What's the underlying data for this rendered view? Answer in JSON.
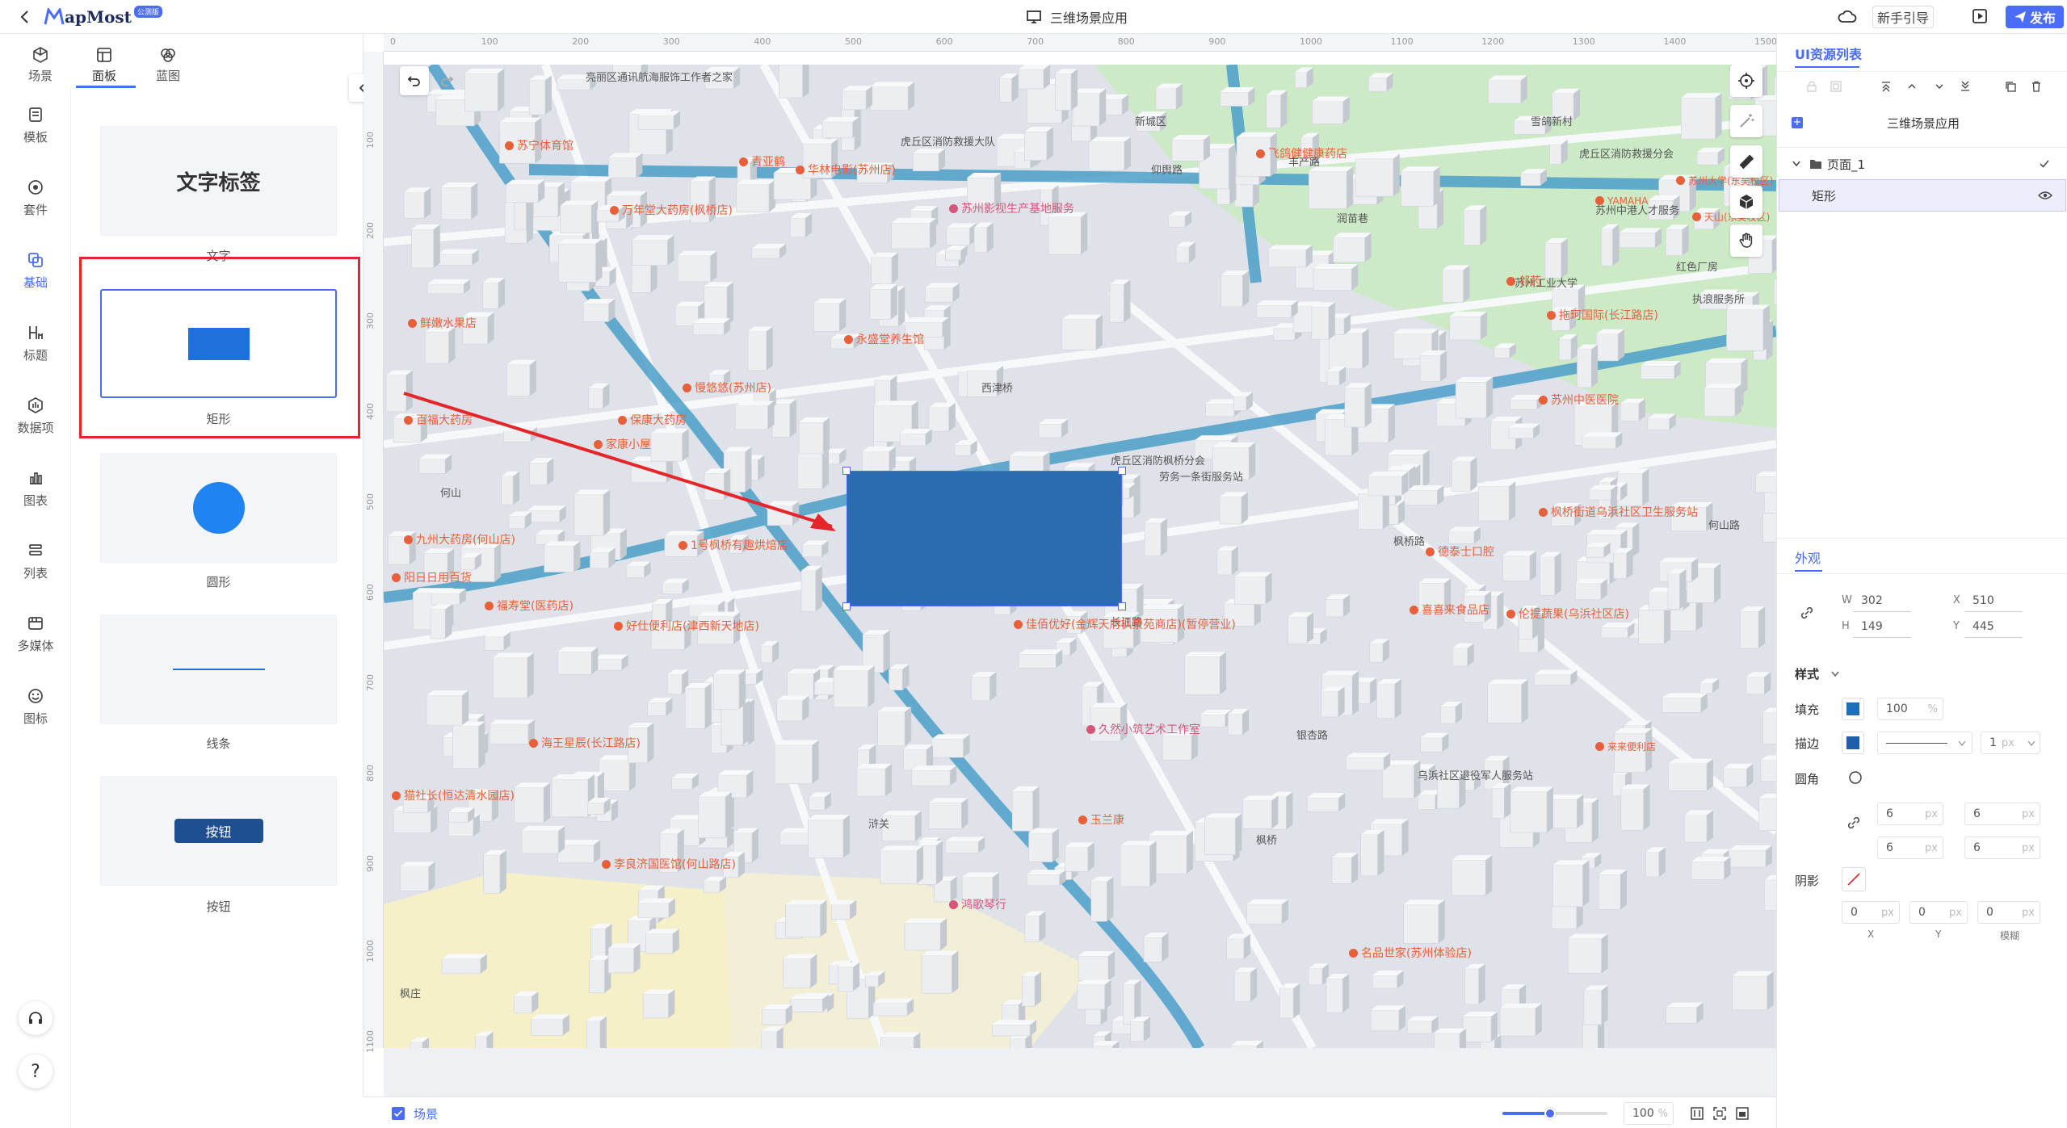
{
  "app": {
    "logo_text": "apMost",
    "logo_badge": "公测版",
    "title": "三维场景应用",
    "guide_label": "新手引导",
    "publish_label": "发布"
  },
  "top_tabs": [
    {
      "label": "场景",
      "icon": "scene-icon"
    },
    {
      "label": "面板",
      "icon": "panel-icon"
    },
    {
      "label": "蓝图",
      "icon": "blueprint-icon"
    }
  ],
  "rail": [
    {
      "label": "模板",
      "icon": "template-icon"
    },
    {
      "label": "套件",
      "icon": "suite-icon"
    },
    {
      "label": "基础",
      "icon": "basic-icon",
      "active": true
    },
    {
      "label": "标题",
      "icon": "heading-icon"
    },
    {
      "label": "数据项",
      "icon": "data-item-icon"
    },
    {
      "label": "图表",
      "icon": "chart-icon"
    },
    {
      "label": "列表",
      "icon": "list-icon"
    },
    {
      "label": "多媒体",
      "icon": "media-icon"
    },
    {
      "label": "图标",
      "icon": "emoji-icon"
    }
  ],
  "components": {
    "text": {
      "preview": "文字标签",
      "label": "文字"
    },
    "rect": {
      "label": "矩形"
    },
    "circle": {
      "label": "圆形"
    },
    "line": {
      "label": "线条"
    },
    "button": {
      "preview": "按钮",
      "label": "按钮"
    }
  },
  "ruler": {
    "top": [
      "0",
      "100",
      "200",
      "300",
      "400",
      "500",
      "600",
      "700",
      "800",
      "900",
      "1000",
      "1100",
      "1200",
      "1300",
      "1400",
      "1500"
    ],
    "left": [
      "100",
      "200",
      "300",
      "400",
      "500",
      "600",
      "700",
      "800",
      "900",
      "1000",
      "1100"
    ]
  },
  "map": {
    "labels": [
      "亮丽区通讯航海服饰工作者之家",
      "虎丘区消防救援大队",
      "新城区",
      "仰舆路",
      "丰产路",
      "润苗巷",
      "雪鸽新村",
      "虎丘区消防救援分会",
      "苏州中港人才服务",
      "红色厂房",
      "枫桥路",
      "西津桥",
      "虎丘区消防枫桥分会",
      "劳务一条街服务站",
      "何山",
      "乌浜社区退役军人服务站",
      "执浪服务所",
      "苏州工业大学",
      "浒关",
      "枫桥",
      "长江路",
      "银杏路",
      "何山路",
      "枫庄"
    ],
    "pois": [
      {
        "text": "苏宁体育馆",
        "pink": false
      },
      {
        "text": "青亚鹤",
        "pink": false
      },
      {
        "text": "万年堂大药房(枫桥店)",
        "pink": false
      },
      {
        "text": "飞鸽健健康药店",
        "pink": false
      },
      {
        "text": "苏州影视生产基地服务",
        "pink": true
      },
      {
        "text": "永盛堂养生馆",
        "pink": false
      },
      {
        "text": "慢悠悠(苏州店)",
        "pink": false
      },
      {
        "text": "鲜嫩水果店",
        "pink": false
      },
      {
        "text": "百福大药房",
        "pink": false
      },
      {
        "text": "保康大药房",
        "pink": false
      },
      {
        "text": "家康小屋",
        "pink": false
      },
      {
        "text": "1号枫桥有趣烘焙店",
        "pink": false
      },
      {
        "text": "九州大药房(何山店)",
        "pink": false
      },
      {
        "text": "阳日日用百货",
        "pink": false
      },
      {
        "text": "福寿堂(医药店)",
        "pink": false
      },
      {
        "text": "好仕便利店(津西新天地店)",
        "pink": false
      },
      {
        "text": "佳佰优好(金辉天府枫景苑商店)(暂停营业)",
        "pink": false
      },
      {
        "text": "海王星辰(长江路店)",
        "pink": false
      },
      {
        "text": "久然小筑艺术工作室",
        "pink": true
      },
      {
        "text": "猫社长(恒达清水园店)",
        "pink": false
      },
      {
        "text": "玉兰康",
        "pink": false
      },
      {
        "text": "李良济国医馆(何山路店)",
        "pink": false
      },
      {
        "text": "鸿歌琴行",
        "pink": true
      },
      {
        "text": "名品世家(苏州体验店)",
        "pink": false
      },
      {
        "text": "来来便利店",
        "pink": false
      },
      {
        "text": "喜喜来食品店",
        "pink": false
      },
      {
        "text": "伦提蔬果(乌浜社区店)",
        "pink": false
      },
      {
        "text": "德泰士口腔",
        "pink": false
      },
      {
        "text": "枫桥街道乌浜社区卫生服务站",
        "pink": false
      },
      {
        "text": "苏州中医医院",
        "pink": false
      },
      {
        "text": "拖珂国际(长江路店)",
        "pink": false
      },
      {
        "text": "邻药",
        "pink": false
      },
      {
        "text": "YAMAHA",
        "pink": false
      },
      {
        "text": "苏州大学(东吴校区)",
        "pink": false
      },
      {
        "text": "天山(东吴校区)",
        "pink": false
      },
      {
        "text": "华林电影(苏州店)",
        "pink": false
      }
    ]
  },
  "right_panel": {
    "title": "UI资源列表",
    "root": "三维场景应用",
    "page": "页面_1",
    "item": "矩形",
    "appearance": "外观",
    "w_label": "W",
    "w": "302",
    "h_label": "H",
    "h": "149",
    "x_label": "X",
    "x": "510",
    "y_label": "Y",
    "y": "445",
    "style_label": "样式",
    "fill_label": "填充",
    "fill_opacity": "100",
    "fill_unit": "%",
    "stroke_label": "描边",
    "stroke_width": "1",
    "px": "px",
    "radius_label": "圆角",
    "radius": [
      "6",
      "6",
      "6",
      "6"
    ],
    "shadow_label": "阴影",
    "shadow": [
      "0",
      "0",
      "0"
    ],
    "shadow_axes": [
      "X",
      "Y",
      "模糊"
    ]
  },
  "bottom": {
    "scene_label": "场景",
    "zoom": "100",
    "zoom_unit": "%",
    "zoom_level": 0.45
  },
  "colors": {
    "accent": "#4a6cf7",
    "rect_fill": "#1f6fdc",
    "canvas_rect": "#2b6cb0",
    "highlight": "#e5252a"
  }
}
